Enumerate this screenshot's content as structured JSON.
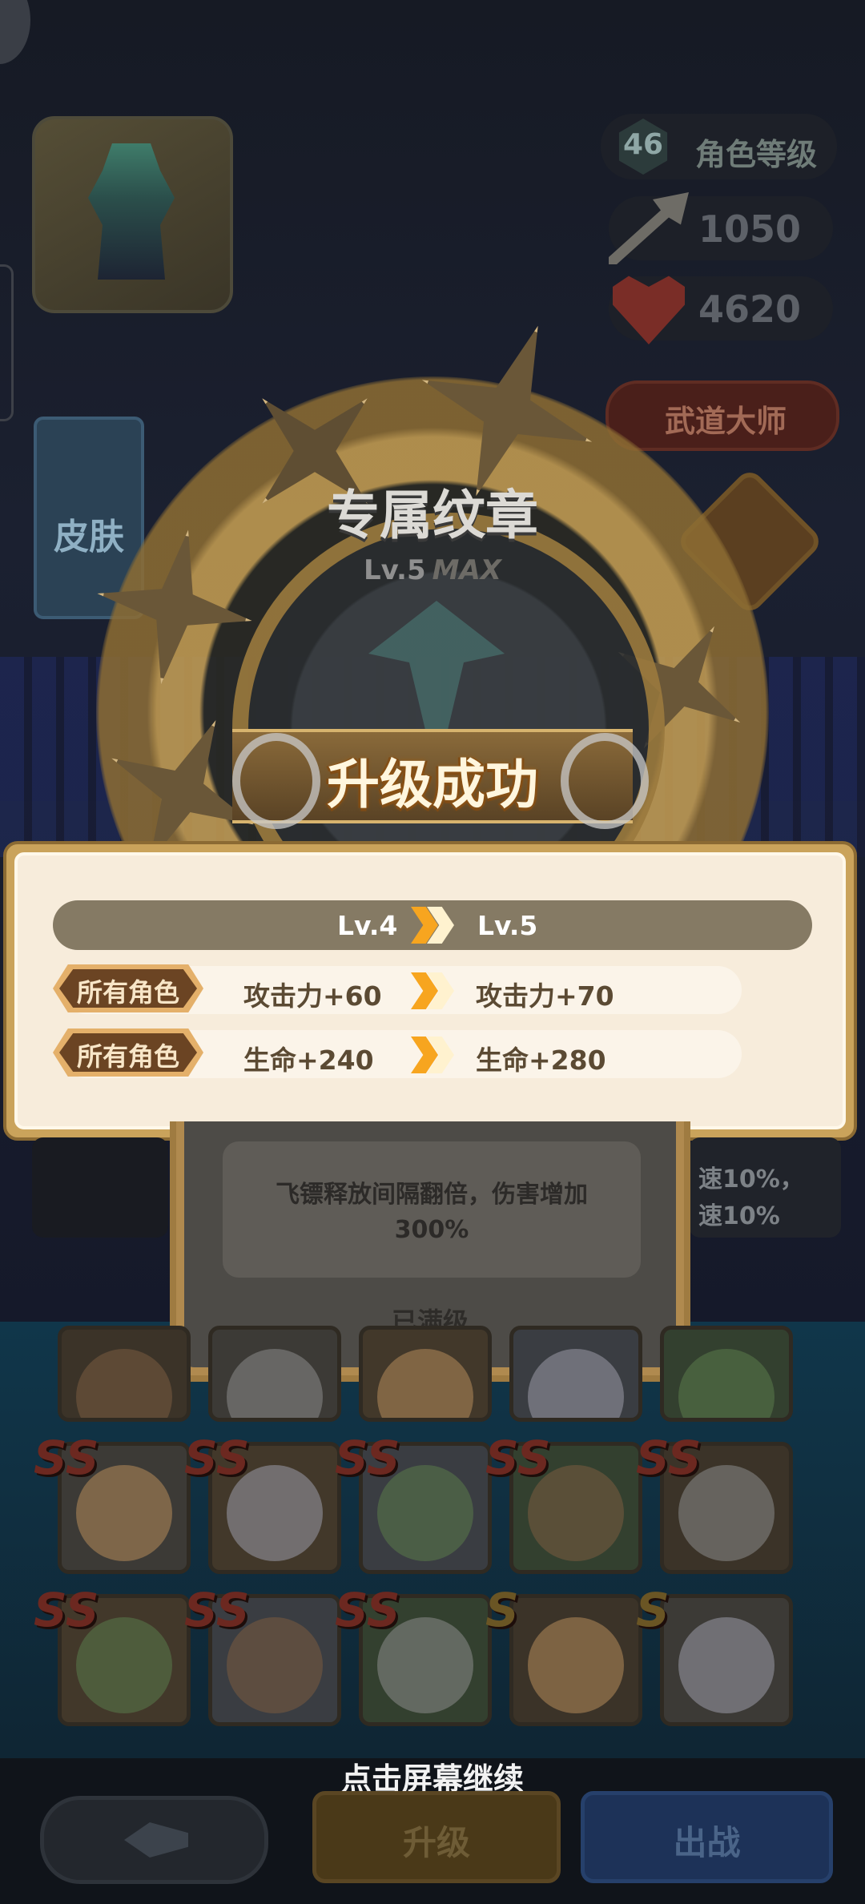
{
  "character": {
    "level": "46",
    "level_label": "角色等级",
    "attack": "1050",
    "hp": "4620",
    "title_badge": "武道大师"
  },
  "side_tabs": {
    "skin": "皮肤"
  },
  "emblem": {
    "name": "专属纹章",
    "level": "Lv.5",
    "max_tag": "MAX"
  },
  "upgrade_result": {
    "banner": "升级成功",
    "level_from": "Lv.4",
    "level_to": "Lv.5",
    "rows": [
      {
        "target": "所有角色",
        "from": "攻击力+60",
        "to": "攻击力+70"
      },
      {
        "target": "所有角色",
        "from": "生命+240",
        "to": "生命+280"
      }
    ]
  },
  "emblem_card": {
    "description": "飞镖释放间隔翻倍，伤害增加300%",
    "status": "已满级",
    "side_text": "速10%，\n速10%"
  },
  "hero_grid": {
    "rows": [
      [
        "",
        "",
        "",
        "",
        ""
      ],
      [
        "SS",
        "SS",
        "SS",
        "SS",
        "SS"
      ],
      [
        "SS",
        "SS",
        "SS",
        "S",
        "S"
      ]
    ]
  },
  "footer": {
    "tap_hint": "点击屏幕继续",
    "upgrade_button": "升级",
    "battle_button": "出战"
  },
  "colors": {
    "gold": "#caa35b",
    "panel_bg": "#f7ecdb",
    "tag_brown": "#6b4423",
    "arrow_orange": "#f7a51f"
  }
}
